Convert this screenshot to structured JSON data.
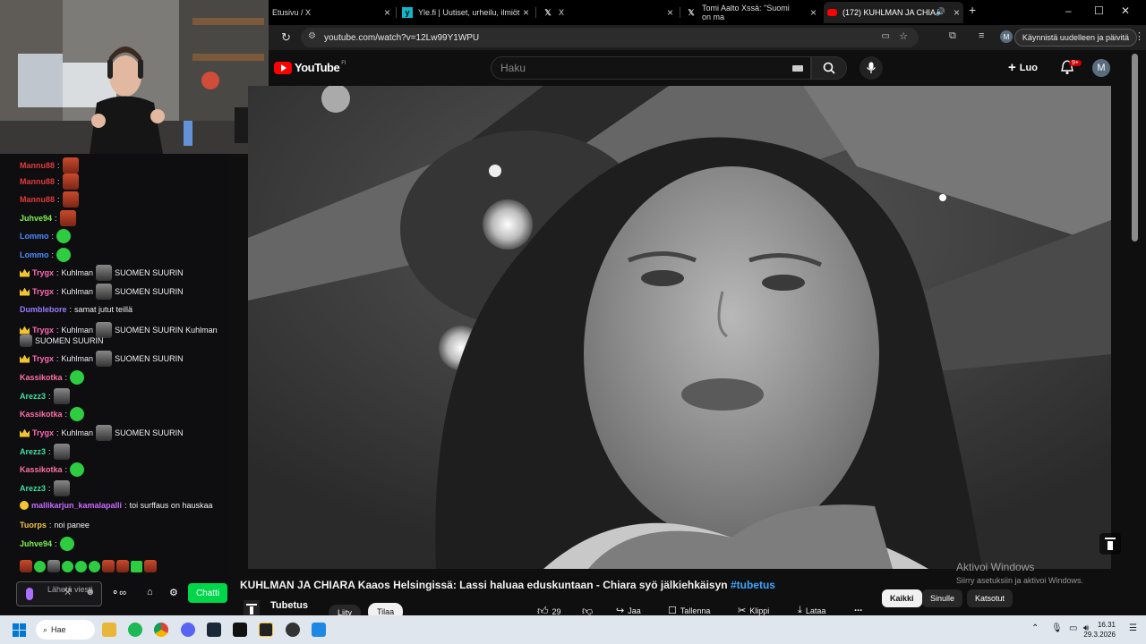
{
  "browser": {
    "tabs": [
      {
        "title": "Etusivu / X"
      },
      {
        "title": "Yle.fi | Uutiset, urheilu, ilmiöt"
      },
      {
        "title": "X"
      },
      {
        "title": "Tomi Aalto Xssä: \"Suomi on ma"
      },
      {
        "title": "(172) KUHLMAN JA CHIARA"
      }
    ],
    "new_tab": "+",
    "url": "youtube.com/watch?v=12Lw99Y1WPU",
    "restart_label": "Käynnistä uudelleen ja päivitä",
    "profile_initial": "M"
  },
  "youtube": {
    "logo_text": "YouTube",
    "region": "FI",
    "search_placeholder": "Haku",
    "create_label": "Luo",
    "notif_count": "9+",
    "avatar_initial": "M"
  },
  "chat": {
    "messages": [
      {
        "user": "Mannu88",
        "text": "",
        "color": "#e03a3a"
      },
      {
        "user": "Mannu88",
        "text": "",
        "color": "#e03a3a"
      },
      {
        "user": "Mannu88",
        "text": "",
        "color": "#e03a3a"
      },
      {
        "user": "Juhve94",
        "text": "",
        "color": "#7cf24b"
      },
      {
        "user": "Lommo",
        "text": "",
        "color": "#4d8dff"
      },
      {
        "user": "Lommo",
        "text": "",
        "color": "#4d8dff"
      },
      {
        "user": "Trygx",
        "text": "Kuhlman",
        "text2": "SUOMEN SUURIN",
        "color": "#ff69b4"
      },
      {
        "user": "Trygx",
        "text": "Kuhlman",
        "text2": "SUOMEN SUURIN",
        "color": "#ff69b4"
      },
      {
        "user": "Dumblebore",
        "text": "samat jutut teillä",
        "color": "#9b7bff"
      },
      {
        "user": "Trygx",
        "text": "Kuhlman",
        "text2": "SUOMEN SUURIN Kuhlman",
        "text3": "SUOMEN SUURIN",
        "color": "#ff69b4"
      },
      {
        "user": "Trygx",
        "text": "Kuhlman",
        "text2": "SUOMEN SUURIN",
        "color": "#ff69b4"
      },
      {
        "user": "Kassikotka",
        "text": "",
        "color": "#ff6fa8"
      },
      {
        "user": "Arezz3",
        "text": "",
        "color": "#3ee0a0"
      },
      {
        "user": "Kassikotka",
        "text": "",
        "color": "#ff6fa8"
      },
      {
        "user": "Trygx",
        "text": "Kuhlman",
        "text2": "SUOMEN SUURIN",
        "color": "#ff69b4"
      },
      {
        "user": "Arezz3",
        "text": "",
        "color": "#3ee0a0"
      },
      {
        "user": "Kassikotka",
        "text": "",
        "color": "#ff6fa8"
      },
      {
        "user": "Arezz3",
        "text": "",
        "color": "#3ee0a0"
      },
      {
        "user": "mallikarjun_kamalapalli",
        "text": "toi surffaus on hauskaa",
        "color": "#c76bff"
      },
      {
        "user": "Tuorps",
        "text": "noi panee",
        "color": "#f5c542"
      },
      {
        "user": "Juhve94",
        "text": "",
        "color": "#7cf24b"
      }
    ],
    "input_placeholder": "Lähetä viesti",
    "send_label": "Chatti"
  },
  "video": {
    "title": "KUHLMAN JA CHIARA Kaaos Helsingissä: Lassi haluaa eduskuntaan - Chiara syö jälkiehkäisyn",
    "hashtag": "#tubetus",
    "channel": "Tubetus",
    "join_label": "Liity",
    "subscribe_label": "Tilaa",
    "likes": "29",
    "share_label": "Jaa",
    "save_label": "Tallenna",
    "clip_label": "Klippi",
    "download_label": "Lataa",
    "more_label": "...",
    "chips": [
      "Kaikki",
      "Sinulle",
      "Katsotut"
    ]
  },
  "watermark": {
    "line1": "Aktivoi Windows",
    "line2": "Siirry asetuksiin ja aktivoi Windows."
  },
  "taskbar": {
    "search_label": "Hae",
    "time": "16.31",
    "date": "29.3.2026"
  },
  "colors": {
    "yt_red": "#ff0000",
    "link_blue": "#3ea6ff",
    "chat_send_green": "#00d64a"
  }
}
